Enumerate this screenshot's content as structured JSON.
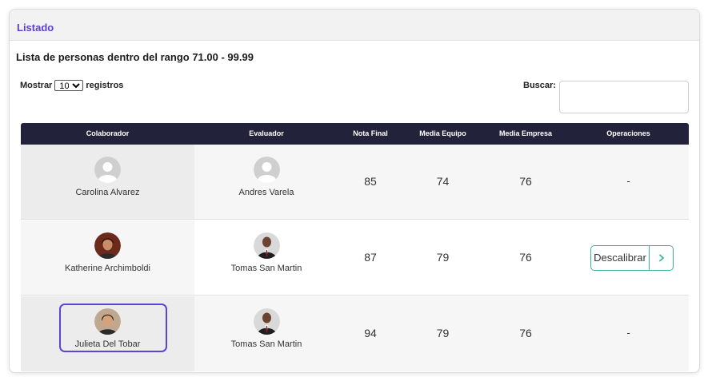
{
  "panel": {
    "title": "Listado"
  },
  "list_title": "Lista de personas dentro del rango 71.00 - 99.99",
  "length_control": {
    "prefix": "Mostrar",
    "selected": "10",
    "suffix": "registros"
  },
  "search": {
    "label": "Buscar:",
    "value": ""
  },
  "table": {
    "headers": [
      "Colaborador",
      "Evaluador",
      "Nota Final",
      "Media Equipo",
      "Media Empresa",
      "Operaciones"
    ],
    "rows": [
      {
        "colaborador": "Carolina Alvarez",
        "colaborador_avatar": "default-avatar-icon",
        "evaluador": "Andres Varela",
        "evaluador_avatar": "default-avatar-icon",
        "nota_final": "85",
        "media_equipo": "74",
        "media_empresa": "76",
        "operacion": "-"
      },
      {
        "colaborador": "Katherine Archimboldi",
        "colaborador_avatar": "woman-photo",
        "evaluador": "Tomas San Martin",
        "evaluador_avatar": "man-in-suit-photo",
        "nota_final": "87",
        "media_equipo": "79",
        "media_empresa": "76",
        "operacion": "Descalibrar"
      },
      {
        "colaborador": "Julieta Del Tobar",
        "colaborador_avatar": "woman-photo",
        "evaluador": "Tomas San Martin",
        "evaluador_avatar": "man-in-suit-photo",
        "nota_final": "94",
        "media_equipo": "79",
        "media_empresa": "76",
        "operacion": "-"
      }
    ]
  },
  "colors": {
    "accent": "#5a3fd1",
    "header_bg": "#22233a",
    "button_border": "#3fb39a",
    "selection": "#5b44d6"
  }
}
